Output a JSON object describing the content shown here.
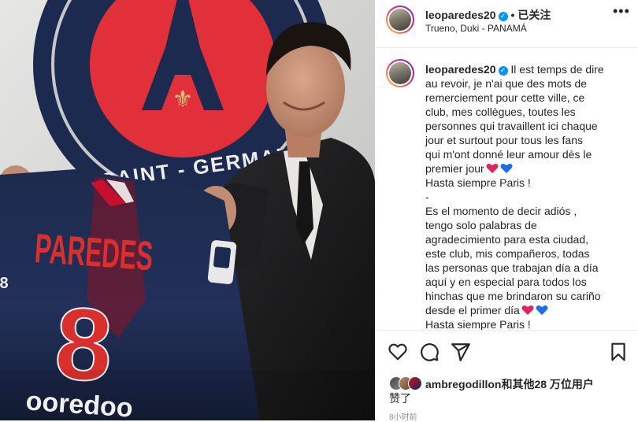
{
  "post": {
    "username": "leoparedes20",
    "header_separator": "•",
    "follow_status": "已关注",
    "music": "Trueno, Duki - PANAMÁ",
    "more_icon": "more-horizontal-icon",
    "verified_icon": "verified-badge-icon"
  },
  "photo": {
    "crest_text": "SAINT - GERMAI",
    "jersey_name": "PAREDES",
    "jersey_number": "8",
    "sponsor": "ooredoo",
    "colors": {
      "navy": "#1b2a4e",
      "red": "#c8102e",
      "crest_red": "#e2303a"
    }
  },
  "caption": {
    "username": "leoparedes20",
    "lines": [
      "Il est temps de dire",
      "au revoir, je n'ai que des mots de",
      "remerciement pour cette ville, ce",
      "club, mes collègues, toutes les",
      "personnes qui travaillent ici chaque",
      "jour et surtout pour tous les fans",
      "qui m'ont donné leur amour dès le",
      "premier jour",
      "Hasta siempre Paris !",
      "-",
      "Es el momento de decir adiós ,",
      "tengo solo palabras de",
      "agradecimiento para esta ciudad,",
      "este club, mis compañeros, todas",
      "las personas que trabajan día a día",
      "aquí y en especial para todos los",
      "hinchas que me brindaron su cariño",
      "desde el primer día",
      "Hasta siempre Paris !"
    ],
    "heart_colors": [
      "#e0245e",
      "#1d6ee8"
    ]
  },
  "actions": {
    "like_icon": "heart-icon",
    "comment_icon": "comment-icon",
    "share_icon": "share-icon",
    "save_icon": "bookmark-icon"
  },
  "likes": {
    "user": "ambregodillon",
    "text": "和其他28 万位用户",
    "suffix": "赞了"
  },
  "timestamp": "8小时前"
}
